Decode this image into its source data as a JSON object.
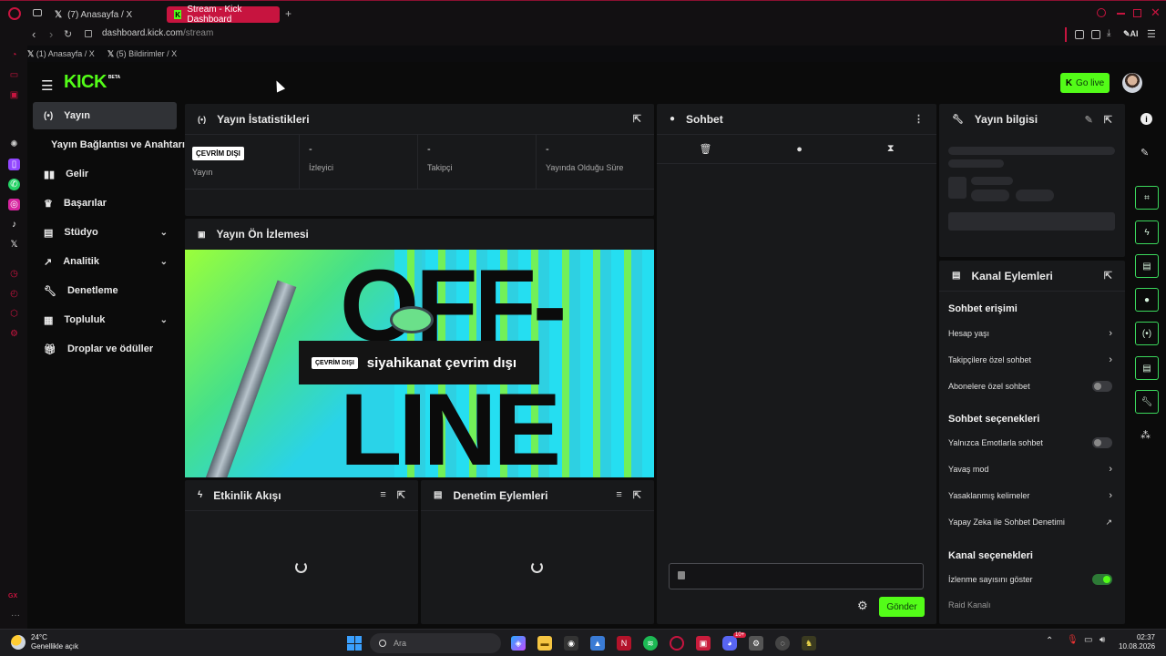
{
  "browser": {
    "tabs": [
      {
        "label": "(7) Anasayfa / X"
      },
      {
        "label": "Stream - Kick Dashboard"
      }
    ],
    "url_host": "dashboard.kick.com",
    "url_path": "/stream",
    "ai_label": "AI",
    "bookmarks": [
      {
        "label": "(1) Anasayfa / X"
      },
      {
        "label": "(5) Bildirimler / X"
      }
    ],
    "gx_label": "GX"
  },
  "header": {
    "logo": "KICK",
    "logo_badge": "BETA",
    "go_live": "Go live"
  },
  "sidebar": {
    "items": [
      {
        "label": "Yayın",
        "icon": "broadcast-icon"
      },
      {
        "label": "Yayın Bağlantısı ve Anahtarı"
      },
      {
        "label": "Gelir",
        "icon": "chart-icon"
      },
      {
        "label": "Başarılar",
        "icon": "trophy-icon"
      },
      {
        "label": "Stüdyo",
        "icon": "studio-icon"
      },
      {
        "label": "Analitik",
        "icon": "analytics-icon"
      },
      {
        "label": "Denetleme",
        "icon": "wrench-icon"
      },
      {
        "label": "Topluluk",
        "icon": "community-icon"
      },
      {
        "label": "Droplar ve ödüller",
        "icon": "gift-icon"
      }
    ]
  },
  "stats": {
    "title": "Yayın İstatistikleri",
    "badge": "ÇEVRİM DIŞI",
    "cols": [
      {
        "value": "",
        "label": "Yayın"
      },
      {
        "value": "-",
        "label": "İzleyici"
      },
      {
        "value": "-",
        "label": "Takipçi"
      },
      {
        "value": "-",
        "label": "Yayında Olduğu Süre"
      }
    ]
  },
  "preview": {
    "title": "Yayın Ön İzlemesi",
    "big_text_1": "OFF-",
    "big_text_2": "LINE",
    "badge": "ÇEVRİM DIŞI",
    "message": "siyahikanat çevrim dışı"
  },
  "activity": {
    "title": "Etkinlik Akışı"
  },
  "moderation": {
    "title": "Denetim Eylemleri"
  },
  "chat": {
    "title": "Sohbet",
    "send": "Gönder"
  },
  "info": {
    "title": "Yayın bilgisi"
  },
  "channel": {
    "title": "Kanal Eylemleri",
    "sec1": "Sohbet erişimi",
    "rows1": [
      {
        "label": "Hesap yaşı"
      },
      {
        "label": "Takipçilere özel sohbet"
      },
      {
        "label": "Abonelere özel sohbet",
        "toggle": false
      }
    ],
    "sec2": "Sohbet seçenekleri",
    "rows2": [
      {
        "label": "Yalnızca Emotlarla sohbet",
        "toggle": false
      },
      {
        "label": "Yavaş mod"
      },
      {
        "label": "Yasaklanmış kelimeler"
      },
      {
        "label": "Yapay Zeka ile Sohbet Denetimi"
      }
    ],
    "sec3": "Kanal seçenekleri",
    "rows3": [
      {
        "label": "İzlenme sayısını göster",
        "toggle": true
      },
      {
        "label": "Raid Kanalı"
      }
    ]
  },
  "taskbar": {
    "temp": "24°C",
    "weather": "Genellikle açık",
    "search": "Ara",
    "time": "02:37",
    "date": "10.08.2026",
    "badge_count": "10+"
  },
  "colors": {
    "accent": "#53fc18",
    "opera_red": "#c7143f"
  }
}
